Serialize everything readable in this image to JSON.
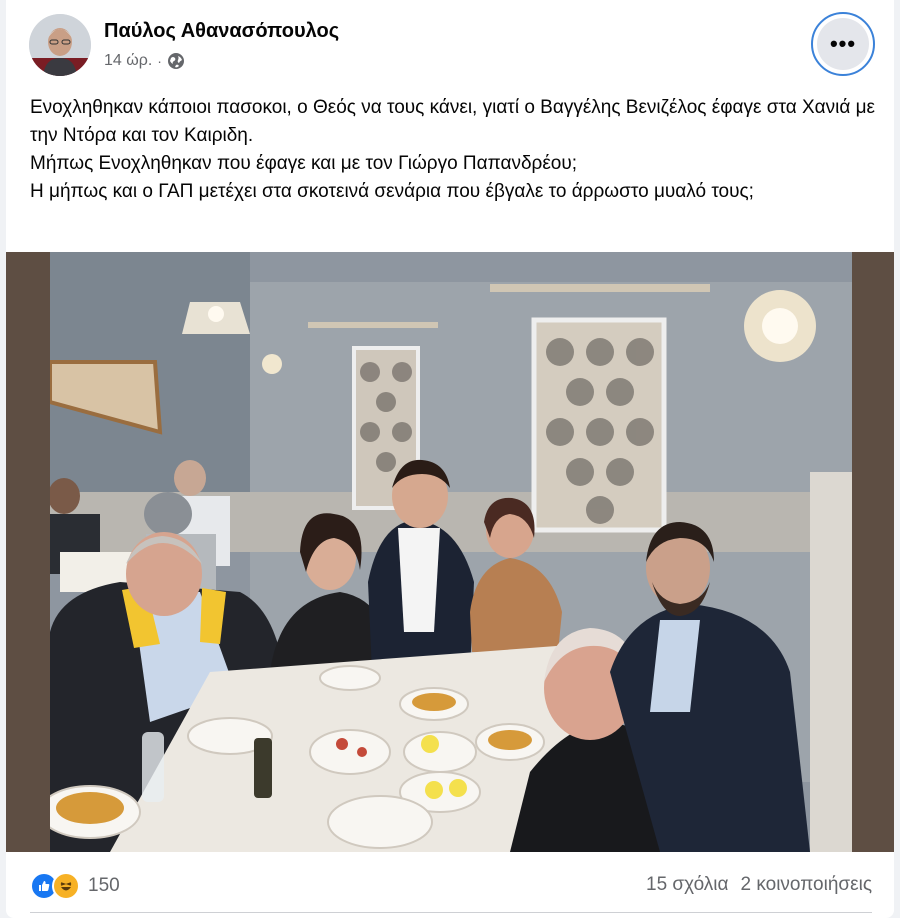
{
  "post": {
    "author": "Παύλος Αθανασόπουλος",
    "time": "14 ώρ.",
    "separator": "·",
    "audience_icon": "globe-icon",
    "more_icon": "more-options-icon",
    "more_label": "•••",
    "text_lines": [
      "Ενοχληθηκαν κάποιοι πασοκοι, ο Θεός να τους κάνει, γιατί ο Βαγγέλης Βενιζέλος έφαγε στα Χανιά με την Ντόρα και τον Καιριδη.",
      "Μήπως Ενοχληθηκαν που έφαγε και με τον Γιώργο Παπανδρέου;",
      "Η μήπως και ο ΓΑΠ μετέχει στα σκοτεινά σενάρια που έβγαλε το άρρωστο μυαλό τους;"
    ]
  },
  "footer": {
    "reaction_icons": [
      "like-icon",
      "haha-icon"
    ],
    "reaction_count": "150",
    "comments": "15 σχόλια",
    "shares": "2 κοινοποιήσεις"
  },
  "colors": {
    "like": "#1877f2",
    "haha": "#f7b125",
    "secondary_text": "#65676b",
    "focus_ring": "#3b82d9"
  }
}
